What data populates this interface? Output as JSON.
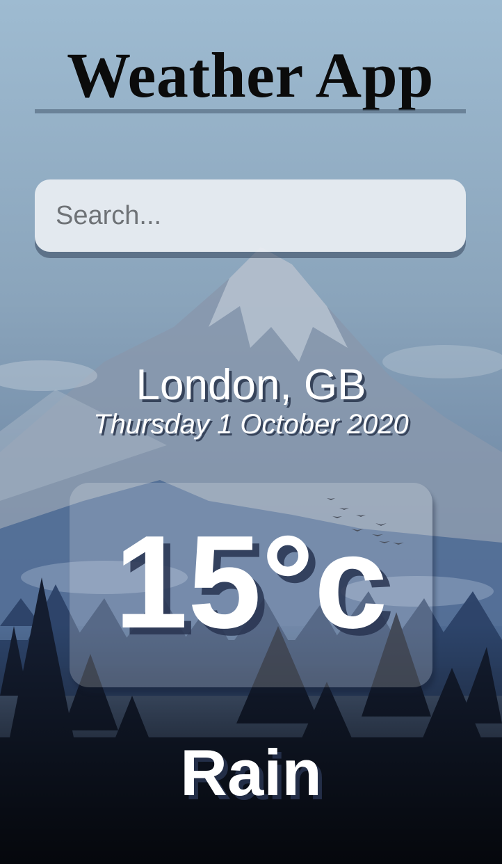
{
  "app": {
    "title": "Weather App"
  },
  "search": {
    "placeholder": "Search...",
    "value": ""
  },
  "weather": {
    "location": "London, GB",
    "date": "Thursday 1 October 2020",
    "temperature": "15°c",
    "condition": "Rain"
  },
  "theme": {
    "sky_top": "#9bb8cf",
    "sky_mid": "#7b94ad",
    "forest_dark": "#111827",
    "title_color": "#0b0b0b",
    "text_color": "#ffffff"
  },
  "background": {
    "scene": "mountain-forest-illustration"
  }
}
